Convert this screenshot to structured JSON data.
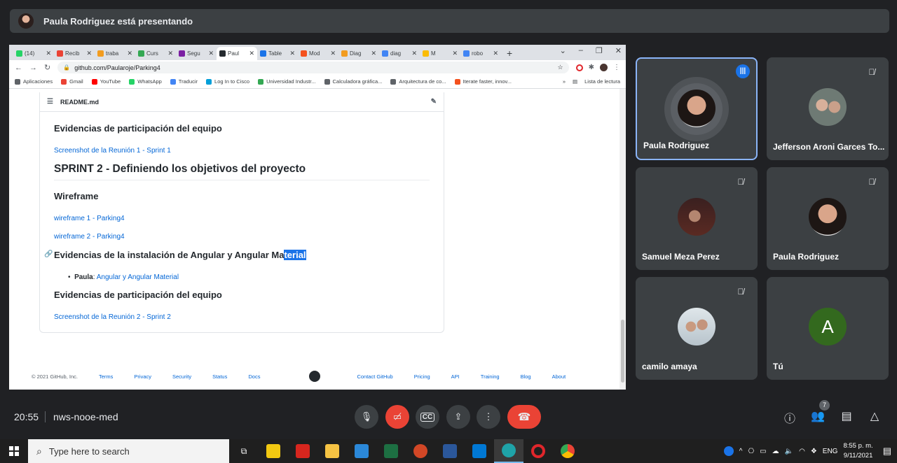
{
  "banner": {
    "text": "Paula Rodriguez está presentando"
  },
  "browser": {
    "tabs": [
      {
        "label": "(14)",
        "color": "#25d366"
      },
      {
        "label": "Recib",
        "color": "#ea4335"
      },
      {
        "label": "traba",
        "color": "#f29c1f"
      },
      {
        "label": "Curs",
        "color": "#34a853"
      },
      {
        "label": "Segu",
        "color": "#7b1fa2"
      },
      {
        "label": "Paul",
        "color": "#24292e"
      },
      {
        "label": "Table",
        "color": "#1a73e8"
      },
      {
        "label": "Mod",
        "color": "#f4511e"
      },
      {
        "label": "Diag",
        "color": "#f29c1f"
      },
      {
        "label": "diag",
        "color": "#4285f4"
      },
      {
        "label": "M",
        "color": "#fbbc04"
      },
      {
        "label": "robo",
        "color": "#4285f4"
      }
    ],
    "url": "github.com/Paularoje/Parking4",
    "bookmarks": [
      {
        "label": "Aplicaciones",
        "color": "#5f6368"
      },
      {
        "label": "Gmail",
        "color": "#ea4335"
      },
      {
        "label": "YouTube",
        "color": "#ff0000"
      },
      {
        "label": "WhatsApp",
        "color": "#25d366"
      },
      {
        "label": "Traducir",
        "color": "#4285f4"
      },
      {
        "label": "Log In to Cisco",
        "color": "#049fd9"
      },
      {
        "label": "Universidad Industr...",
        "color": "#34a853"
      },
      {
        "label": "Calculadora gráfica...",
        "color": "#5f6368"
      },
      {
        "label": "Arquitectura de co...",
        "color": "#5f6368"
      },
      {
        "label": "Iterate faster, innov...",
        "color": "#f4511e"
      }
    ],
    "reading_list": "Lista de lectura"
  },
  "readme": {
    "filename": "README.md",
    "h_evid1": "Evidencias de participación del equipo",
    "link_shot1": "Screenshot de la Reunión 1 - Sprint 1",
    "h_sprint2": "SPRINT 2 - Definiendo los objetivos del proyecto",
    "h_wireframe": "Wireframe",
    "link_wf1": "wireframe 1 - Parking4",
    "link_wf2": "wireframe 2 - Parking4",
    "h_install_pre": "Evidencias de la instalación de Angular y Angular Ma",
    "h_install_sel": "terial",
    "li_name": "Paula",
    "li_link": "Angular y Angular Material",
    "h_evid2": "Evidencias de participación del equipo",
    "link_shot2": "Screenshot de la Reunión 2 - Sprint 2"
  },
  "gh_footer": {
    "copyright": "© 2021 GitHub, Inc.",
    "left": [
      "Terms",
      "Privacy",
      "Security",
      "Status",
      "Docs"
    ],
    "right": [
      "Contact GitHub",
      "Pricing",
      "API",
      "Training",
      "Blog",
      "About"
    ]
  },
  "participants": [
    {
      "name": "Paula Rodriguez",
      "speaking": true
    },
    {
      "name": "Jefferson Aroni Garces To..."
    },
    {
      "name": "Samuel Meza Perez"
    },
    {
      "name": "Paula Rodriguez"
    },
    {
      "name": "camilo amaya"
    },
    {
      "name": "Tú",
      "initial": "A"
    }
  ],
  "meet": {
    "time": "20:55",
    "code": "nws-nooe-med",
    "participant_count": "7"
  },
  "taskbar": {
    "search_placeholder": "Type here to search",
    "lang": "ENG",
    "clock_time": "8:55 p. m.",
    "clock_date": "9/11/2021"
  }
}
